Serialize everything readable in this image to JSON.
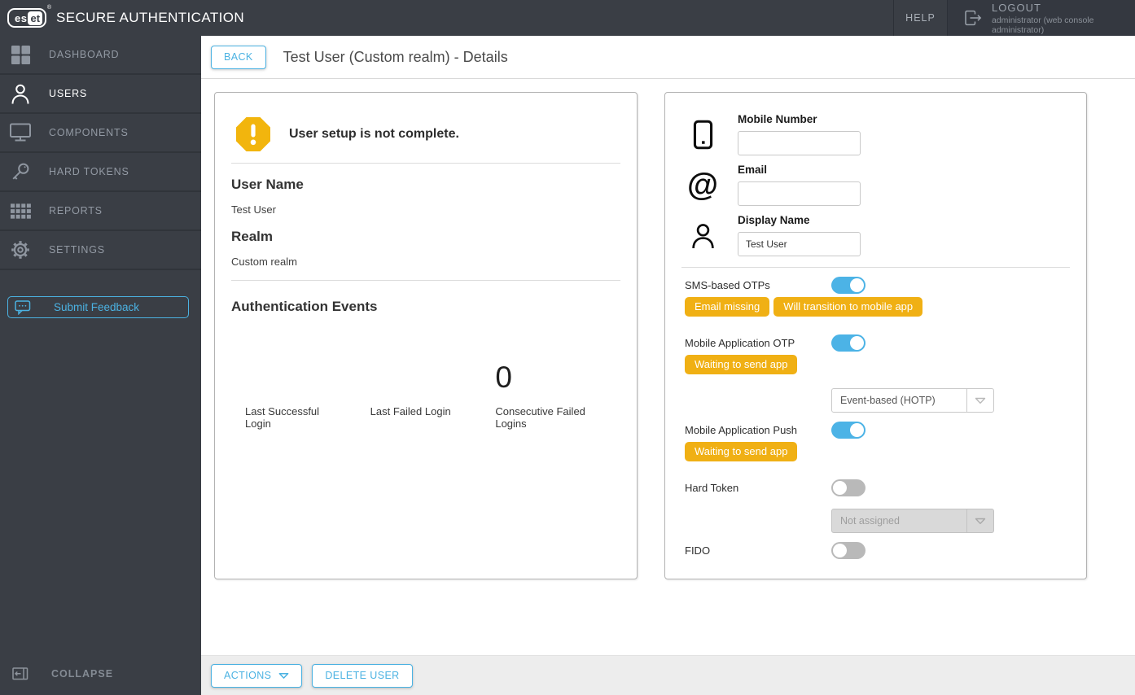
{
  "topbar": {
    "logo_text_left": "es",
    "logo_text_right": "et",
    "logo_reg": "®",
    "brand": "SECURE AUTHENTICATION",
    "help_label": "HELP",
    "logout_label": "LOGOUT",
    "logout_user": "administrator (web console administrator)"
  },
  "sidebar": {
    "items": [
      {
        "label": "DASHBOARD",
        "active": false
      },
      {
        "label": "USERS",
        "active": true
      },
      {
        "label": "COMPONENTS",
        "active": false
      },
      {
        "label": "HARD TOKENS",
        "active": false
      },
      {
        "label": "REPORTS",
        "active": false
      },
      {
        "label": "SETTINGS",
        "active": false
      }
    ],
    "feedback_label": "Submit Feedback",
    "collapse_label": "COLLAPSE"
  },
  "header": {
    "back_label": "BACK",
    "title": "Test User (Custom realm) - Details"
  },
  "summary_card": {
    "warning_text": "User setup is not complete.",
    "user_name_label": "User Name",
    "user_name_value": "Test User",
    "realm_label": "Realm",
    "realm_value": "Custom realm",
    "events_title": "Authentication Events",
    "stats": [
      {
        "label": "Last Successful Login",
        "value": ""
      },
      {
        "label": "Last Failed Login",
        "value": ""
      },
      {
        "label": "Consecutive Failed Logins",
        "value": "0"
      }
    ]
  },
  "details_card": {
    "mobile_number": {
      "label": "Mobile Number",
      "value": ""
    },
    "email": {
      "label": "Email",
      "value": ""
    },
    "display_name": {
      "label": "Display Name",
      "value": "Test User"
    },
    "sms_otp": {
      "label": "SMS-based OTPs",
      "enabled": true,
      "badges": [
        "Email missing",
        "Will transition to mobile app"
      ]
    },
    "mobile_app_otp": {
      "label": "Mobile Application OTP",
      "enabled": true,
      "badge": "Waiting to send app",
      "otp_type_value": "Event-based (HOTP)"
    },
    "mobile_app_push": {
      "label": "Mobile Application Push",
      "enabled": true,
      "badge": "Waiting to send app"
    },
    "hard_token": {
      "label": "Hard Token",
      "enabled": false,
      "assignment_value": "Not assigned"
    },
    "fido": {
      "label": "FIDO",
      "enabled": false
    }
  },
  "footer": {
    "actions_label": "ACTIONS",
    "delete_user_label": "DELETE USER"
  },
  "colors": {
    "accent_blue": "#4bb2e2",
    "toggle_on_blue": "#4cb3e6",
    "badge_amber": "#f0b014",
    "warning_amber": "#f2b50d",
    "topbar_dark": "#3a3e45",
    "logout_block_dark": "#343840"
  }
}
